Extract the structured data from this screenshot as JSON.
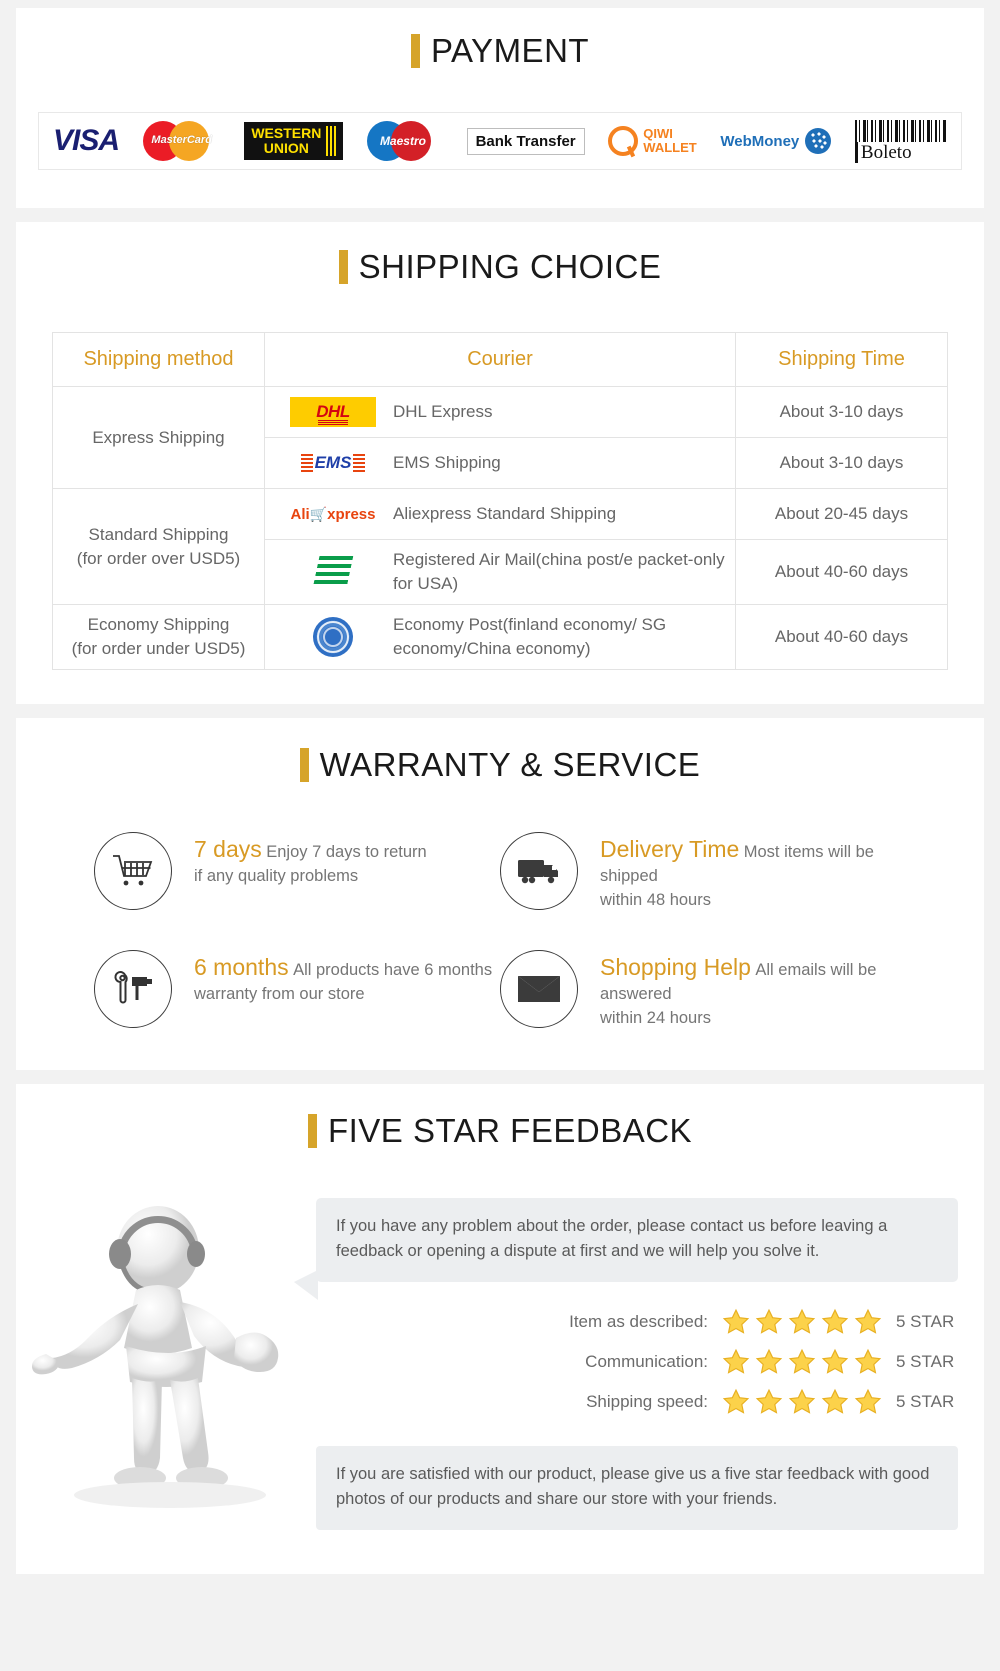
{
  "payment": {
    "title": "PAYMENT",
    "methods": [
      {
        "name": "VISA",
        "icon": "visa-logo"
      },
      {
        "name": "MasterCard",
        "icon": "mastercard-logo"
      },
      {
        "name": "WESTERN UNION",
        "line1": "WESTERN",
        "line2": "UNION",
        "icon": "western-union-logo"
      },
      {
        "name": "Maestro",
        "icon": "maestro-logo"
      },
      {
        "name": "Bank Transfer",
        "icon": "bank-transfer-logo"
      },
      {
        "name": "QIWI WALLET",
        "line1": "QIWI",
        "line2": "WALLET",
        "icon": "qiwi-wallet-logo"
      },
      {
        "name": "WebMoney",
        "icon": "webmoney-logo"
      },
      {
        "name": "Boleto",
        "icon": "boleto-logo"
      }
    ]
  },
  "shipping": {
    "title": "SHIPPING CHOICE",
    "headers": [
      "Shipping method",
      "Courier",
      "Shipping Time"
    ],
    "rows": [
      {
        "method": "Express Shipping",
        "method_sub": "",
        "span": 2,
        "couriers": [
          {
            "logo": "dhl-logo",
            "name": "DHL Express",
            "time": "About 3-10 days"
          },
          {
            "logo": "ems-logo",
            "name": "EMS Shipping",
            "time": "About 3-10 days"
          }
        ]
      },
      {
        "method": "Standard Shipping",
        "method_sub": "(for order over USD5)",
        "span": 2,
        "couriers": [
          {
            "logo": "aliexpress-logo",
            "name": "Aliexpress Standard Shipping",
            "time": "About 20-45 days"
          },
          {
            "logo": "china-post-logo",
            "name": "Registered Air Mail(china post/e packet-only for USA)",
            "time": "About 40-60 days"
          }
        ]
      },
      {
        "method": "Economy Shipping",
        "method_sub": "(for order under USD5)",
        "span": 1,
        "couriers": [
          {
            "logo": "un-post-logo",
            "name": "Economy Post(finland economy/ SG economy/China economy)",
            "time": "About 40-60 days"
          }
        ]
      }
    ]
  },
  "warranty": {
    "title": "WARRANTY & SERVICE",
    "items": [
      {
        "icon": "shopping-cart-icon",
        "title": "7 days",
        "line1": "Enjoy 7 days to return",
        "line2": "if any quality problems"
      },
      {
        "icon": "delivery-truck-icon",
        "title": "Delivery Time",
        "line1": "Most items will be shipped",
        "line2": "within 48 hours"
      },
      {
        "icon": "tools-icon",
        "title": "6 months",
        "line1": "All products have 6 months",
        "line2": "warranty from our store"
      },
      {
        "icon": "envelope-icon",
        "title": "Shopping Help",
        "line1": "All emails will be answered",
        "line2": "within 24 hours"
      }
    ]
  },
  "feedback": {
    "title": "FIVE STAR FEEDBACK",
    "bubble_text": "If you have any problem about the order, please contact us before leaving a feedback or opening a dispute at first and we will help you solve it.",
    "ratings": [
      {
        "label": "Item as described:",
        "stars": 5,
        "value": "5 STAR"
      },
      {
        "label": "Communication:",
        "stars": 5,
        "value": "5 STAR"
      },
      {
        "label": "Shipping speed:",
        "stars": 5,
        "value": "5 STAR"
      }
    ],
    "note_text": "If you are satisfied with our product, please give us a five star feedback with good photos of our products and share our store with your friends.",
    "figure": "support-agent-figure"
  },
  "colors": {
    "accent_gold": "#d6a42a",
    "heading_text": "#1a1a1a",
    "body_text": "#666666",
    "panel_bg": "#ffffff",
    "page_bg": "#f2f2f2",
    "star_gold": "#f6c githubusercontent"
  }
}
